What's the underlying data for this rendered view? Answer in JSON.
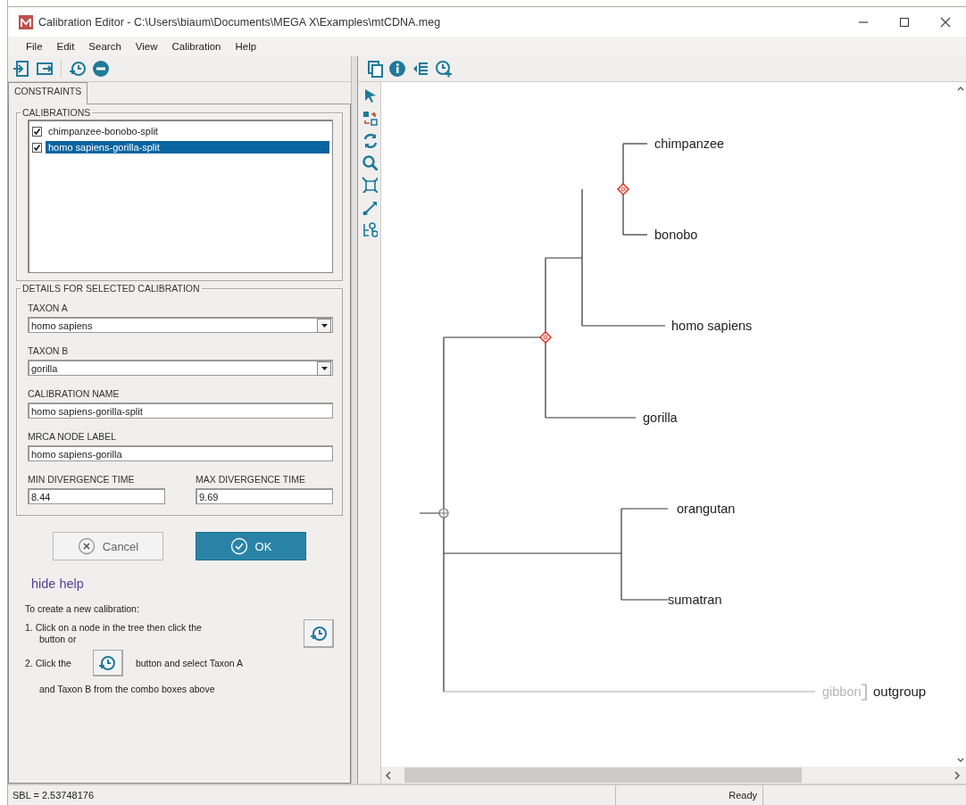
{
  "window": {
    "title": "Calibration Editor - C:\\Users\\biaum\\Documents\\MEGA X\\Examples\\mtCDNA.meg"
  },
  "menu": [
    "File",
    "Edit",
    "Search",
    "View",
    "Calibration",
    "Help"
  ],
  "tabs": [
    {
      "label": "CONSTRAINTS",
      "selected": true
    }
  ],
  "calibrations": {
    "title": "CALIBRATIONS",
    "items": [
      {
        "label": "chimpanzee-bonobo-split",
        "checked": true,
        "selected": false
      },
      {
        "label": "homo sapiens-gorilla-split",
        "checked": true,
        "selected": true
      }
    ]
  },
  "details": {
    "title": "DETAILS FOR SELECTED CALIBRATION",
    "fields": [
      {
        "kind": "combo",
        "label": "TAXON A",
        "value": "homo sapiens"
      },
      {
        "kind": "combo",
        "label": "TAXON B",
        "value": "gorilla"
      },
      {
        "kind": "text",
        "label": "CALIBRATION NAME",
        "value": "homo sapiens-gorilla-split"
      },
      {
        "kind": "text",
        "label": "MRCA NODE LABEL",
        "value": "homo sapiens-gorilla"
      }
    ],
    "times": [
      {
        "label": "MIN DIVERGENCE TIME",
        "value": "8.44"
      },
      {
        "label": "MAX DIVERGENCE TIME",
        "value": "9.69"
      }
    ]
  },
  "buttons": [
    {
      "label": "Cancel",
      "kind": "cancel"
    },
    {
      "label": "OK",
      "kind": "ok"
    }
  ],
  "help": {
    "link": "hide help",
    "heading": "To create a new calibration:",
    "step_1": "1. Click on a node in the tree then click the",
    "step_1_cont": "button or",
    "step_2": "2. Click the",
    "step_2_after": "button and select Taxon A",
    "step_2_cont": "and Taxon B from the combo boxes above"
  },
  "tree": {
    "leaves": [
      {
        "label": "chimpanzee",
        "outgroup": false
      },
      {
        "label": "bonobo",
        "outgroup": false
      },
      {
        "label": "homo sapiens",
        "outgroup": false
      },
      {
        "label": "gorilla",
        "outgroup": false
      },
      {
        "label": "orangutan",
        "outgroup": false
      },
      {
        "label": "sumatran",
        "outgroup": false
      },
      {
        "label": "gibbon",
        "outgroup": true
      }
    ],
    "outgroup_label": "outgroup",
    "nodes": [
      {
        "calibrated": true
      },
      {
        "calibrated": true
      },
      {
        "calibrated": false
      }
    ]
  },
  "status_bar": {
    "sbl": "SBL = 2.53748176",
    "state": "Ready"
  }
}
